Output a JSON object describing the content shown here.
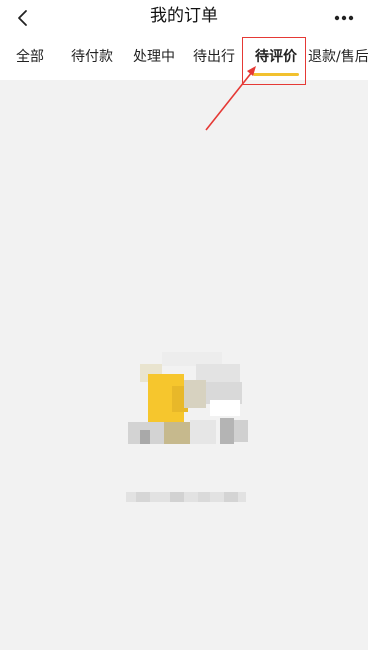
{
  "header": {
    "title": "我的订单",
    "back_icon": "chevron-left-icon",
    "more_icon": "more-horizontal-icon"
  },
  "tabs": [
    {
      "label": "全部",
      "active": false
    },
    {
      "label": "待付款",
      "active": false
    },
    {
      "label": "处理中",
      "active": false
    },
    {
      "label": "待出行",
      "active": false
    },
    {
      "label": "待评价",
      "active": true
    },
    {
      "label": "退款/售后",
      "active": false
    }
  ],
  "colors": {
    "accent": "#f2c12e",
    "annotation": "#e53935",
    "background": "#f2f2f2"
  },
  "empty_state": {
    "illustration": "empty-orders-illustration-pixelated",
    "message_blurred": true
  }
}
